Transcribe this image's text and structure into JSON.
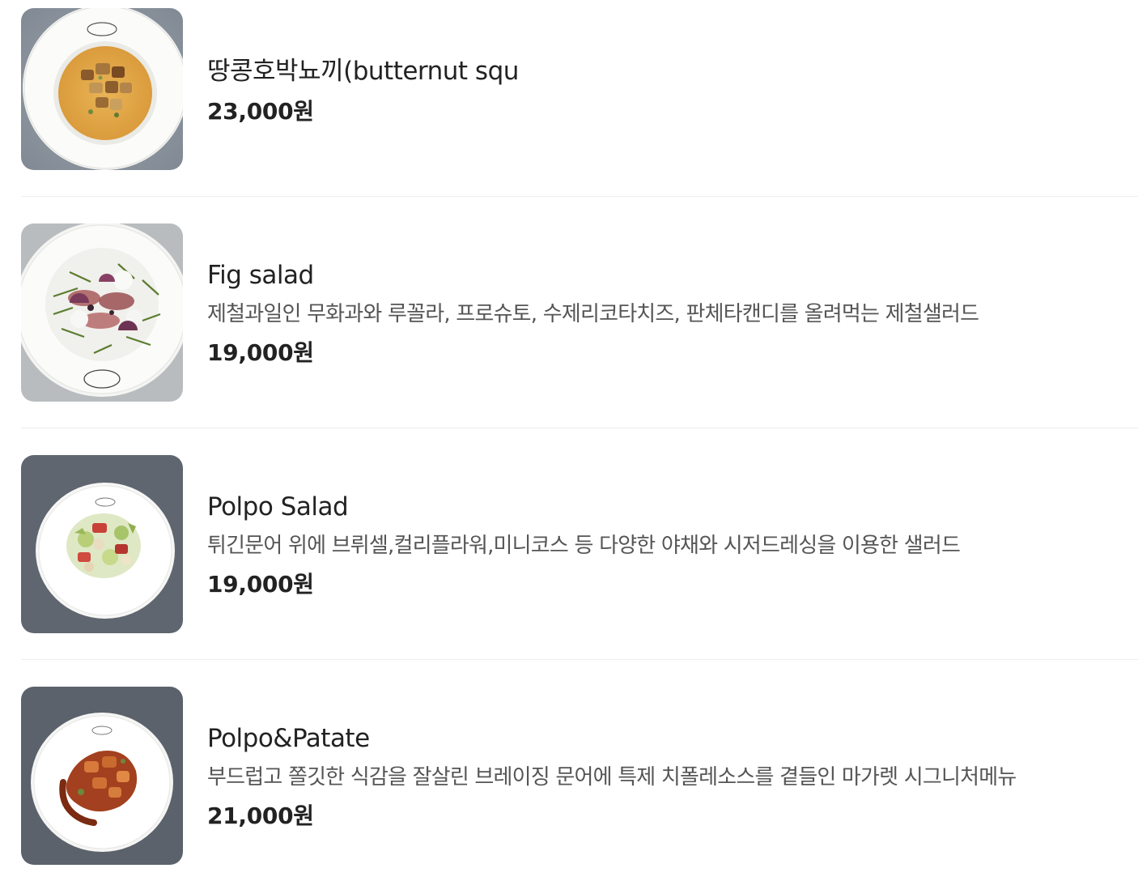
{
  "menu": {
    "items": [
      {
        "name": "땅콩호박뇨끼(butternut squ",
        "description": "",
        "price": "23,000원",
        "image_icon": "butternut-squash-gnocchi-photo"
      },
      {
        "name": "Fig salad",
        "description": "제철과일인 무화과와 루꼴라, 프로슈토, 수제리코타치즈, 판체타캔디를 올려먹는 제철샐러드",
        "price": "19,000원",
        "image_icon": "fig-salad-photo"
      },
      {
        "name": "Polpo Salad",
        "description": "튀긴문어 위에 브뤼셀,컬리플라워,미니코스 등 다양한 야채와 시저드레싱을 이용한 샐러드",
        "price": "19,000원",
        "image_icon": "polpo-salad-photo"
      },
      {
        "name": "Polpo&Patate",
        "description": "부드럽고 쫄깃한 식감을 잘살린 브레이징 문어에 특제 치폴레소스를 곁들인 마가렛 시그니처메뉴",
        "price": "21,000원",
        "image_icon": "polpo-patate-photo"
      }
    ]
  },
  "colors": {
    "text_primary": "#222222",
    "text_secondary": "#555555",
    "divider": "#eeeeee"
  }
}
